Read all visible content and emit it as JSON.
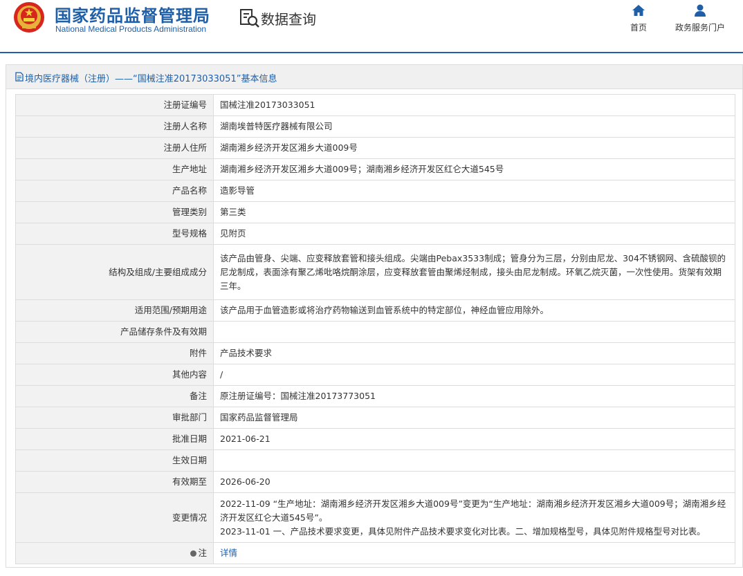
{
  "header": {
    "brand_cn": "国家药品监督管理局",
    "brand_en": "National Medical Products Administration",
    "section_label": "数据查询",
    "nav": {
      "home": "首页",
      "portal": "政务服务门户"
    }
  },
  "panel": {
    "title": "境内医疗器械（注册）——“国械注准20173033051”基本信息"
  },
  "rows": [
    {
      "label": "注册证编号",
      "value": "国械注准20173033051"
    },
    {
      "label": "注册人名称",
      "value": "湖南埃普特医疗器械有限公司"
    },
    {
      "label": "注册人住所",
      "value": "湖南湘乡经济开发区湘乡大道009号"
    },
    {
      "label": "生产地址",
      "value": "湖南湘乡经济开发区湘乡大道009号；湖南湘乡经济开发区红仑大道545号"
    },
    {
      "label": "产品名称",
      "value": "造影导管"
    },
    {
      "label": "管理类别",
      "value": "第三类"
    },
    {
      "label": "型号规格",
      "value": "见附页"
    },
    {
      "label": "结构及组成/主要组成成分",
      "value": "该产品由管身、尖端、应变释放套管和接头组成。尖端由Pebax3533制成；管身分为三层，分别由尼龙、304不锈钢网、含硫酸钡的尼龙制成，表面涂有聚乙烯吡咯烷酮涂层，应变释放套管由聚烯烃制成，接头由尼龙制成。环氧乙烷灭菌，一次性使用。货架有效期三年。"
    },
    {
      "label": "适用范围/预期用途",
      "value": "该产品用于血管造影或将治疗药物输送到血管系统中的特定部位，神经血管应用除外。"
    },
    {
      "label": "产品储存条件及有效期",
      "value": ""
    },
    {
      "label": "附件",
      "value": "产品技术要求"
    },
    {
      "label": "其他内容",
      "value": "/"
    },
    {
      "label": "备注",
      "value": "原注册证编号：国械注准20173773051"
    },
    {
      "label": "审批部门",
      "value": "国家药品监督管理局"
    },
    {
      "label": "批准日期",
      "value": "2021-06-21"
    },
    {
      "label": "生效日期",
      "value": ""
    },
    {
      "label": "有效期至",
      "value": "2026-06-20"
    }
  ],
  "change_row": {
    "label": "变更情况",
    "line1": "2022-11-09 “生产地址：湖南湘乡经济开发区湘乡大道009号”变更为“生产地址：湖南湘乡经济开发区湘乡大道009号；湖南湘乡经济开发区红仑大道545号”。",
    "line2": "2023-11-01 一、产品技术要求变更，具体见附件产品技术要求变化对比表。二、增加规格型号，具体见附件规格型号对比表。"
  },
  "note_row": {
    "label": "注",
    "link": "详情"
  },
  "colors": {
    "brand_blue": "#1f5fa8",
    "label_bg": "#f2f2f2",
    "border": "#dcdcdc"
  }
}
